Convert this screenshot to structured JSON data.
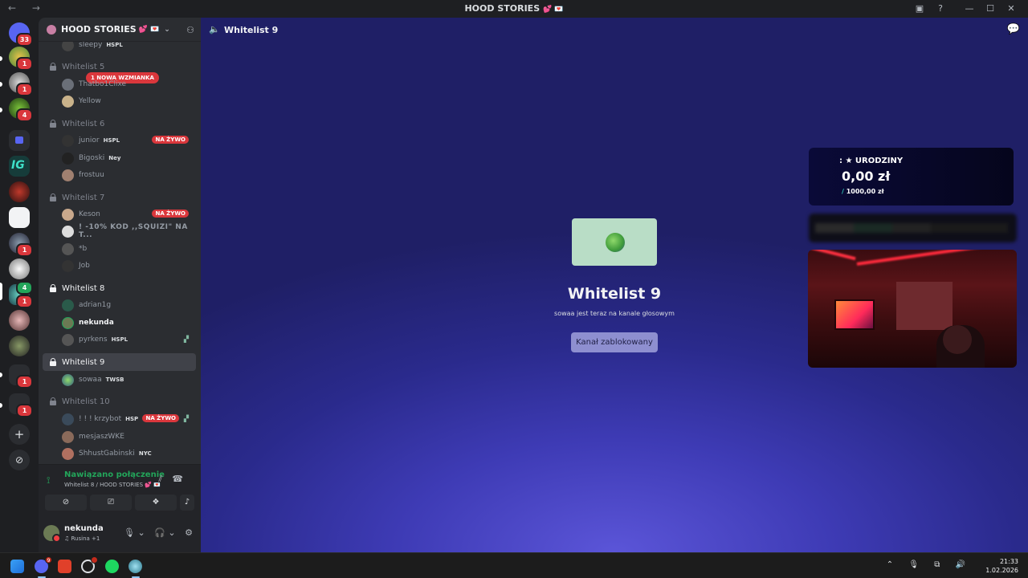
{
  "window": {
    "nav": "← →",
    "title": "HOOD STORIES",
    "title_deco": "💕 💌",
    "buttons": [
      "▣",
      "?",
      "—",
      "☐",
      "✕"
    ]
  },
  "rail": {
    "badges": [
      "33",
      "1",
      "1",
      "4",
      "1",
      "1",
      "1",
      "1"
    ],
    "green_badge": "4"
  },
  "guild": {
    "name": "HOOD STORIES",
    "hearts": "💕 💌",
    "chevron": "⌄",
    "invite_icon": "person-add"
  },
  "mention_banner": "1 NOWA WZMIANKA",
  "channels": {
    "top_member": {
      "name": "sleepy",
      "tag": "HSPL"
    },
    "wl5": {
      "name": "Whitelist 5",
      "members": [
        {
          "name": "Thatbo1Clixe"
        },
        {
          "name": "Yellow"
        }
      ]
    },
    "wl6": {
      "name": "Whitelist 6",
      "members": [
        {
          "name": "junior",
          "tag": "HSPL",
          "live": "NA ŻYWO"
        },
        {
          "name": "Bigoski",
          "tag": "Ney"
        },
        {
          "name": "frostuu"
        }
      ]
    },
    "wl7": {
      "name": "Whitelist 7",
      "members": [
        {
          "name": "Keson",
          "live": "NA ŻYWO"
        },
        {
          "name": "! -10% KOD ,,SQUIZI\" NA T..."
        },
        {
          "name": "*b"
        },
        {
          "name": "Job"
        }
      ]
    },
    "wl8": {
      "name": "Whitelist 8",
      "members": [
        {
          "name": "adrian1g"
        },
        {
          "name": "nekunda"
        },
        {
          "name": "pyrkens",
          "tag": "HSPL"
        }
      ]
    },
    "wl9": {
      "name": "Whitelist 9",
      "members": [
        {
          "name": "sowaa",
          "tag": "TWSB"
        }
      ]
    },
    "wl10": {
      "name": "Whitelist 10",
      "members": [
        {
          "name": "! ! ! krzybot",
          "tag": "HSP",
          "live": "NA ŻYWO"
        },
        {
          "name": "mesjaszWKE"
        },
        {
          "name": "ShhustGabinski",
          "tag": "NYC"
        }
      ]
    }
  },
  "voice_panel": {
    "status": "Nawiązano połączenie",
    "location": "Whitelist 8 / HOOD STORIES",
    "hearts": "💕 💌"
  },
  "user": {
    "name": "nekunda",
    "activity": "♫ Rusina +1",
    "controls": [
      "🎙 ⌄",
      "🎧 ⌄",
      "⚙"
    ]
  },
  "main": {
    "channel_title": "Whitelist 9",
    "heading": "Whitelist 9",
    "subtitle": "sowaa jest teraz na kanale głosowym",
    "button_label": "Kanał zablokowany"
  },
  "donation": {
    "label": ": ★ URODZINY",
    "amount": "0,00 zł",
    "goal_slash": "/",
    "goal": "1000,00 zł"
  },
  "taskbar": {
    "discord_badge": "9",
    "time": "21:33",
    "date": "1.02.2026",
    "tray": "⌃ 🎙 ⧉ 🔊"
  },
  "colors": {
    "live": "#da373c",
    "connected": "#23a55a",
    "accent_bg": "#3e3bb5"
  }
}
